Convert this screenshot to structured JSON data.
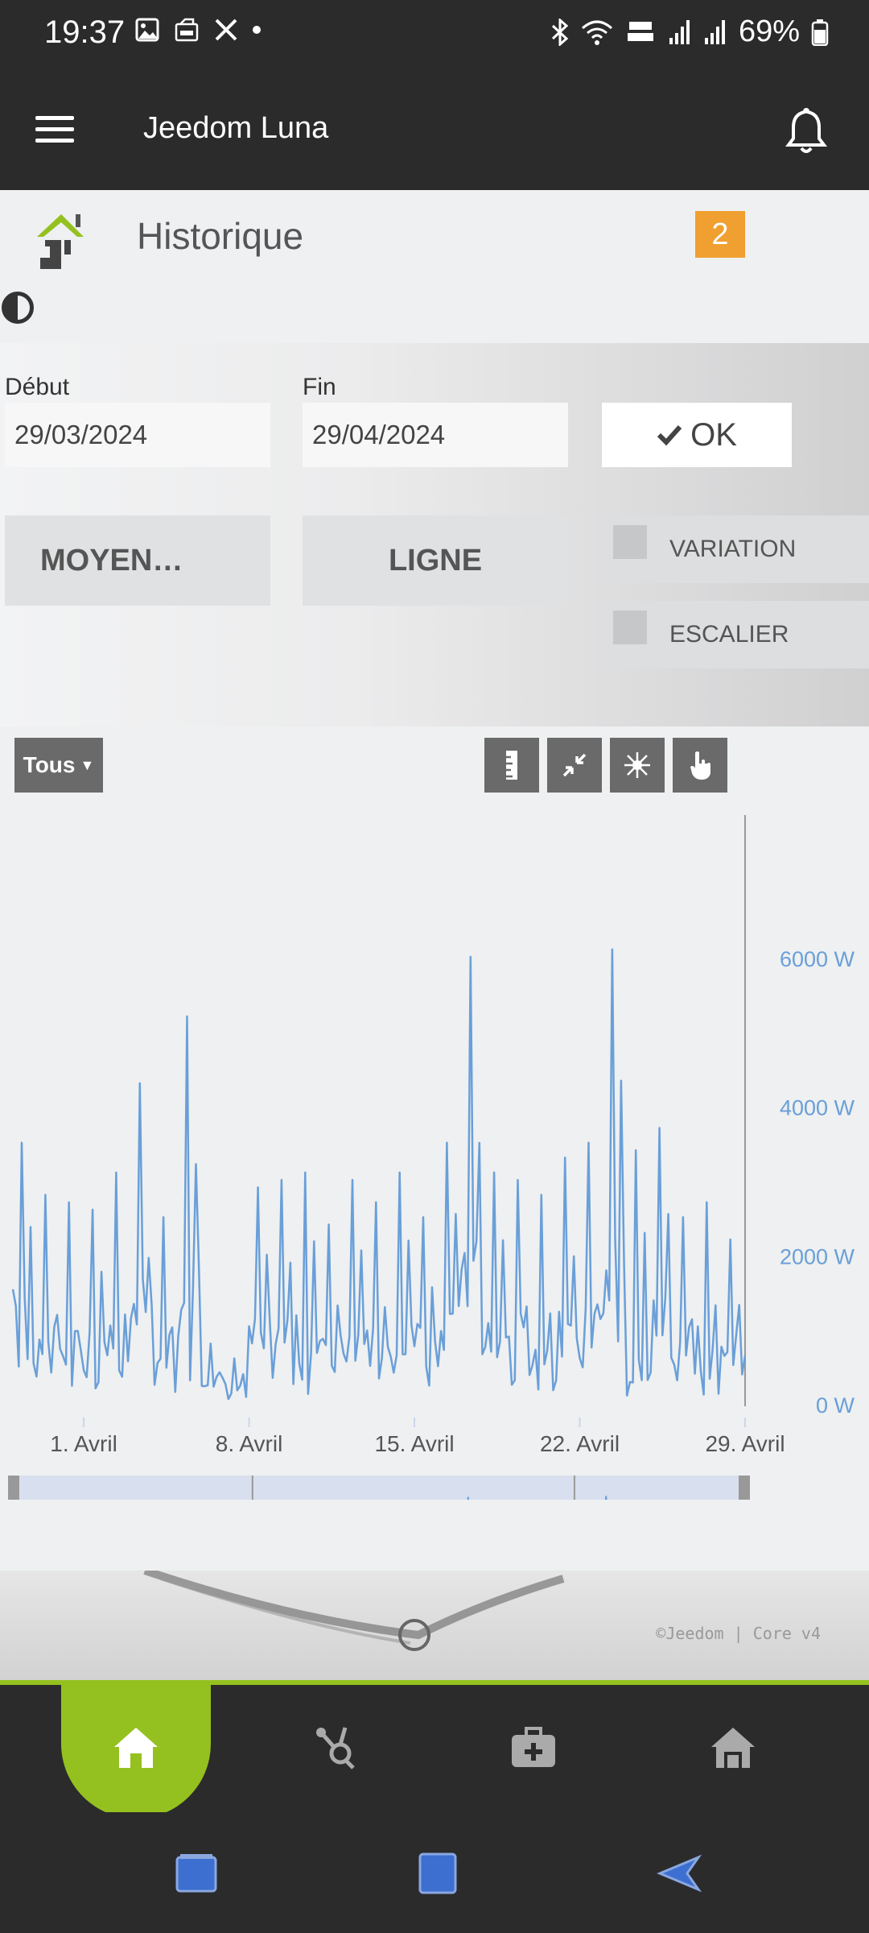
{
  "status_bar": {
    "time": "19:37",
    "battery": "69%"
  },
  "app": {
    "title": "Jeedom Luna"
  },
  "page": {
    "title": "Historique",
    "badge": "2"
  },
  "form": {
    "start_label": "Début",
    "start_value": "29/03/2024",
    "end_label": "Fin",
    "end_value": "29/04/2024",
    "ok_label": "OK",
    "mode_button": "MOYEN…",
    "type_button": "LIGNE",
    "variation_label": "VARIATION",
    "escalier_label": "ESCALIER"
  },
  "chart_toolbar": {
    "filter_label": "Tous"
  },
  "chart_data": {
    "type": "line",
    "title": "",
    "xlabel": "",
    "ylabel": "",
    "x_ticks": [
      "1. Avril",
      "8. Avril",
      "15. Avril",
      "22. Avril",
      "29. Avril"
    ],
    "y_ticks": [
      "0 W",
      "2000 W",
      "4000 W",
      "6000 W"
    ],
    "ylim": [
      0,
      7000
    ],
    "y_unit": "W",
    "xlim": [
      "2024-03-29",
      "2024-04-29"
    ],
    "navigator_labels": [
      "8. Avril",
      "22. Avril"
    ],
    "series": [
      {
        "color": "#6a9fd8",
        "x": [
          "2024-03-29",
          "2024-03-30",
          "2024-03-31",
          "2024-04-01",
          "2024-04-02",
          "2024-04-03",
          "2024-04-04",
          "2024-04-05",
          "2024-04-06",
          "2024-04-07",
          "2024-04-08",
          "2024-04-09",
          "2024-04-10",
          "2024-04-11",
          "2024-04-12",
          "2024-04-13",
          "2024-04-14",
          "2024-04-15",
          "2024-04-16",
          "2024-04-17",
          "2024-04-18",
          "2024-04-19",
          "2024-04-20",
          "2024-04-21",
          "2024-04-22",
          "2024-04-23",
          "2024-04-24",
          "2024-04-25",
          "2024-04-26",
          "2024-04-27",
          "2024-04-28",
          "2024-04-29"
        ],
        "peaks": [
          3500,
          2800,
          2700,
          2600,
          3100,
          4300,
          2500,
          5200,
          800,
          600,
          2900,
          3000,
          3100,
          2400,
          3000,
          2700,
          3100,
          2500,
          3500,
          6000,
          3100,
          3000,
          2800,
          3300,
          3500,
          6100,
          3400,
          3700,
          2500,
          2700,
          2200,
          5400
        ],
        "lows": [
          400,
          300,
          200,
          100,
          150,
          200,
          100,
          300,
          80,
          50,
          200,
          150,
          100,
          150,
          200,
          100,
          150,
          200,
          100,
          200,
          150,
          200,
          100,
          150,
          200,
          150,
          100,
          200,
          150,
          100,
          200,
          100
        ]
      }
    ]
  },
  "footer": {
    "copyright": "©Jeedom | Core v4"
  },
  "colors": {
    "accent": "#94c11f",
    "badge": "#f0a030",
    "series": "#6a9fd8",
    "dark": "#2b2b2c"
  }
}
